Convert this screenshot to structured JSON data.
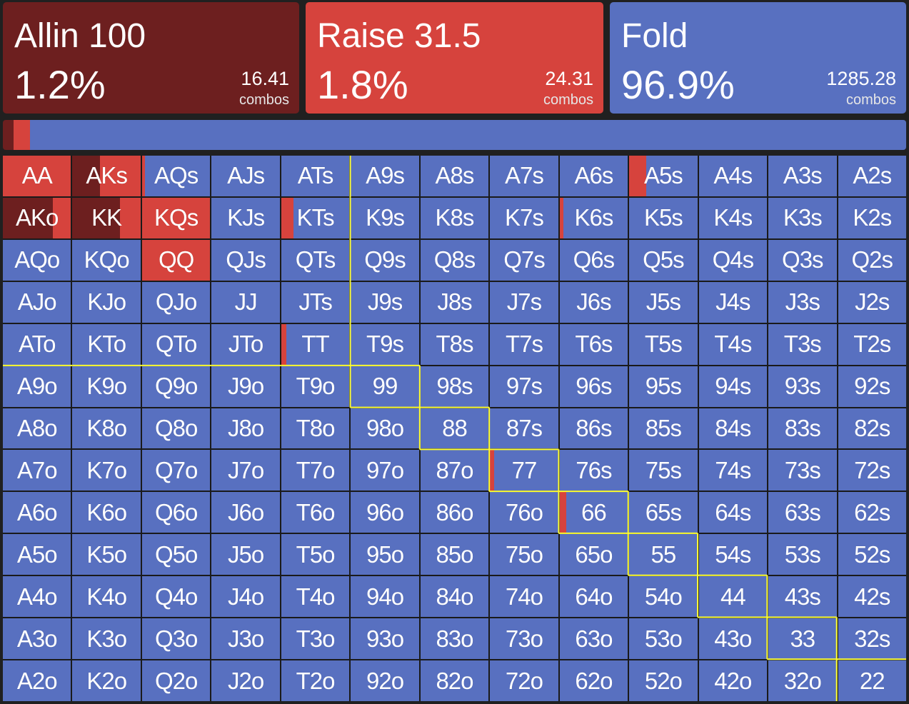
{
  "colors": {
    "allin": "#6d1f1f",
    "raise": "#d6433d",
    "fold": "#5870c0",
    "boundary": "#ffff33"
  },
  "actions": [
    {
      "title": "Allin 100",
      "pct": "1.2%",
      "combos": "16.41",
      "unit": "combos"
    },
    {
      "title": "Raise 31.5",
      "pct": "1.8%",
      "combos": "24.31",
      "unit": "combos"
    },
    {
      "title": "Fold",
      "pct": "96.9%",
      "combos": "1285.28",
      "unit": "combos"
    }
  ],
  "frequency_bar": {
    "allin": 0.012,
    "raise": 0.018,
    "fold": 0.969
  },
  "hands": [
    [
      "AA",
      "AKs",
      "AQs",
      "AJs",
      "ATs",
      "A9s",
      "A8s",
      "A7s",
      "A6s",
      "A5s",
      "A4s",
      "A3s",
      "A2s"
    ],
    [
      "AKo",
      "KK",
      "KQs",
      "KJs",
      "KTs",
      "K9s",
      "K8s",
      "K7s",
      "K6s",
      "K5s",
      "K4s",
      "K3s",
      "K2s"
    ],
    [
      "AQo",
      "KQo",
      "QQ",
      "QJs",
      "QTs",
      "Q9s",
      "Q8s",
      "Q7s",
      "Q6s",
      "Q5s",
      "Q4s",
      "Q3s",
      "Q2s"
    ],
    [
      "AJo",
      "KJo",
      "QJo",
      "JJ",
      "JTs",
      "J9s",
      "J8s",
      "J7s",
      "J6s",
      "J5s",
      "J4s",
      "J3s",
      "J2s"
    ],
    [
      "ATo",
      "KTo",
      "QTo",
      "JTo",
      "TT",
      "T9s",
      "T8s",
      "T7s",
      "T6s",
      "T5s",
      "T4s",
      "T3s",
      "T2s"
    ],
    [
      "A9o",
      "K9o",
      "Q9o",
      "J9o",
      "T9o",
      "99",
      "98s",
      "97s",
      "96s",
      "95s",
      "94s",
      "93s",
      "92s"
    ],
    [
      "A8o",
      "K8o",
      "Q8o",
      "J8o",
      "T8o",
      "98o",
      "88",
      "87s",
      "86s",
      "85s",
      "84s",
      "83s",
      "82s"
    ],
    [
      "A7o",
      "K7o",
      "Q7o",
      "J7o",
      "T7o",
      "97o",
      "87o",
      "77",
      "76s",
      "75s",
      "74s",
      "73s",
      "72s"
    ],
    [
      "A6o",
      "K6o",
      "Q6o",
      "J6o",
      "T6o",
      "96o",
      "86o",
      "76o",
      "66",
      "65s",
      "64s",
      "63s",
      "62s"
    ],
    [
      "A5o",
      "K5o",
      "Q5o",
      "J5o",
      "T5o",
      "95o",
      "85o",
      "75o",
      "65o",
      "55",
      "54s",
      "53s",
      "52s"
    ],
    [
      "A4o",
      "K4o",
      "Q4o",
      "J4o",
      "T4o",
      "94o",
      "84o",
      "74o",
      "64o",
      "54o",
      "44",
      "43s",
      "42s"
    ],
    [
      "A3o",
      "K3o",
      "Q3o",
      "J3o",
      "T3o",
      "93o",
      "83o",
      "73o",
      "63o",
      "53o",
      "43o",
      "33",
      "32s"
    ],
    [
      "A2o",
      "K2o",
      "Q2o",
      "J2o",
      "T2o",
      "92o",
      "82o",
      "72o",
      "62o",
      "52o",
      "42o",
      "32o",
      "22"
    ]
  ],
  "strategy": {
    "AA": {
      "allin": 0.0,
      "raise": 1.0
    },
    "AKs": {
      "allin": 0.4,
      "raise": 0.6
    },
    "AQs": {
      "allin": 0.0,
      "raise": 0.04
    },
    "A5s": {
      "allin": 0.0,
      "raise": 0.25
    },
    "AKo": {
      "allin": 0.73,
      "raise": 0.27
    },
    "KK": {
      "allin": 0.7,
      "raise": 0.3
    },
    "KQs": {
      "allin": 0.0,
      "raise": 1.0
    },
    "KTs": {
      "allin": 0.0,
      "raise": 0.18
    },
    "K6s": {
      "allin": 0.0,
      "raise": 0.06
    },
    "QQ": {
      "allin": 0.0,
      "raise": 1.0
    },
    "TT": {
      "allin": 0.0,
      "raise": 0.08
    },
    "77": {
      "allin": 0.0,
      "raise": 0.06
    },
    "66": {
      "allin": 0.0,
      "raise": 0.1
    }
  },
  "boundary_range": [
    "AA",
    "AKs",
    "AQs",
    "AJs",
    "ATs",
    "AKo",
    "KK",
    "KQs",
    "KJs",
    "KTs",
    "AQo",
    "KQo",
    "QQ",
    "QJs",
    "QTs",
    "AJo",
    "KJo",
    "QJo",
    "JJ",
    "JTs",
    "ATo",
    "KTo",
    "QTo",
    "JTo",
    "TT",
    "99",
    "88",
    "77",
    "66",
    "55",
    "44",
    "33",
    "22"
  ]
}
